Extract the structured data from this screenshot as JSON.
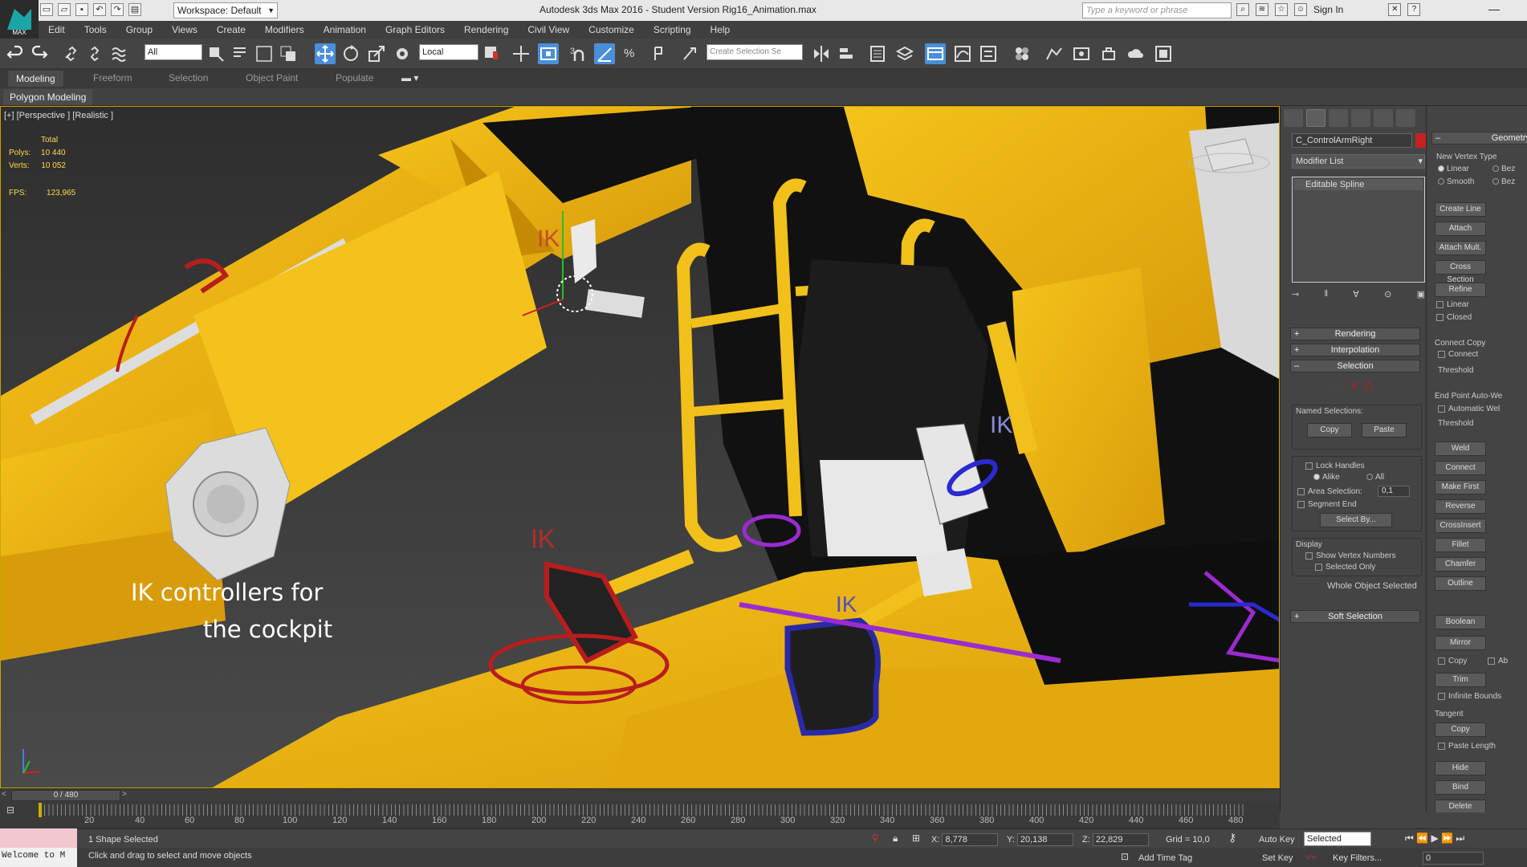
{
  "app": {
    "logo_text": "MAX",
    "window_title": "Autodesk 3ds Max 2016 - Student Version    Rig16_Animation.max",
    "workspace": "Workspace: Default",
    "search_placeholder": "Type a keyword or phrase",
    "sign_in": "Sign In"
  },
  "menu": [
    "Edit",
    "Tools",
    "Group",
    "Views",
    "Create",
    "Modifiers",
    "Animation",
    "Graph Editors",
    "Rendering",
    "Civil View",
    "Customize",
    "Scripting",
    "Help"
  ],
  "toolbar": {
    "selection_filter": "All",
    "ref_coord": "Local",
    "named_selection_placeholder": "Create Selection Se"
  },
  "ribbon": {
    "tabs": [
      "Modeling",
      "Freeform",
      "Selection",
      "Object Paint",
      "Populate"
    ],
    "active_tab": "Modeling",
    "sub": "Polygon Modeling"
  },
  "viewport": {
    "label": "[+] [Perspective ] [Realistic ]",
    "stats": {
      "total_label": "Total",
      "polys_label": "Polys:",
      "polys": "10 440",
      "verts_label": "Verts:",
      "verts": "10 052",
      "fps_label": "FPS:",
      "fps": "123,965"
    },
    "ik_labels": [
      "IK",
      "IK",
      "IK",
      "IK"
    ],
    "overlay_line1": "IK controllers for",
    "overlay_line2": "the cockpit"
  },
  "command_panel": {
    "object_name": "C_ControlArmRight",
    "modifier_list": "Modifier List",
    "stack_item": "Editable Spline",
    "rollouts": {
      "rendering": "Rendering",
      "interpolation": "Interpolation",
      "selection": "Selection",
      "soft_selection": "Soft Selection"
    },
    "named_selections": "Named Selections:",
    "copy": "Copy",
    "paste": "Paste",
    "lock_handles": "Lock Handles",
    "alike": "Alike",
    "all": "All",
    "area_selection": "Area Selection:",
    "area_value": "0,1",
    "segment_end": "Segment End",
    "select_by": "Select By...",
    "display": "Display",
    "show_vertex_numbers": "Show Vertex Numbers",
    "selected_only": "Selected Only",
    "whole_object_selected": "Whole Object Selected"
  },
  "geometry": {
    "title": "Geometry",
    "new_vertex_type": "New Vertex Type",
    "linear": "Linear",
    "bez": "Bez",
    "smooth": "Smooth",
    "bez2": "Bez",
    "buttons": [
      "Create Line",
      "Attach",
      "Attach Mult.",
      "Cross Section",
      "Refine"
    ],
    "linear2": "Linear",
    "closed": "Closed",
    "connect_copy": "Connect Copy",
    "connect": "Connect",
    "threshold": "Threshold",
    "end_point_auto_weld": "End Point Auto-We",
    "automatic_weld": "Automatic Wel",
    "threshold2": "Threshold",
    "buttons2": [
      "Weld",
      "Connect",
      "Make First",
      "Reverse",
      "CrossInsert",
      "Fillet",
      "Chamfer",
      "Outline"
    ],
    "boolean": "Boolean",
    "mirror": "Mirror",
    "copy": "Copy",
    "ab": "Ab",
    "trim": "Trim",
    "infinite_bounds": "Infinite Bounds",
    "tangent": "Tangent",
    "tcopy": "Copy",
    "paste_length": "Paste Length",
    "hide": "Hide",
    "bind": "Bind",
    "delete": "Delete"
  },
  "timeline": {
    "frame_display": "0 / 480",
    "ticks": [
      "20",
      "40",
      "60",
      "80",
      "100",
      "120",
      "140",
      "160",
      "180",
      "200",
      "220",
      "240",
      "260",
      "280",
      "300",
      "320",
      "340",
      "360",
      "380",
      "400",
      "420",
      "440",
      "460",
      "480"
    ]
  },
  "status": {
    "maxscript": "Welcome to M",
    "selection_count": "1 Shape Selected",
    "prompt": "Click and drag to select and move objects",
    "x_label": "X:",
    "x": "8,778",
    "y_label": "Y:",
    "y": "20,138",
    "z_label": "Z:",
    "z": "22,829",
    "grid": "Grid = 10,0",
    "add_time_tag": "Add Time Tag",
    "auto_key": "Auto Key",
    "set_key": "Set Key",
    "selected": "Selected",
    "key_filters": "Key Filters...",
    "frame": "0"
  }
}
